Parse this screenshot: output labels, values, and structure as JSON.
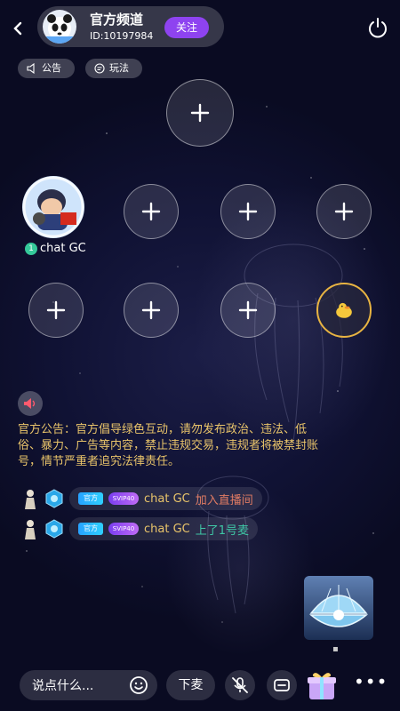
{
  "header": {
    "back_icon": "chevron-left-icon",
    "room_title": "官方频道",
    "room_id": "ID:10197984",
    "follow_label": "关注",
    "power_icon": "power-icon"
  },
  "chips": {
    "announcement_label": "公告",
    "gameplay_label": "玩法"
  },
  "seats": {
    "user_seat_number": "1",
    "user_name": "chat GC"
  },
  "chat": {
    "announcement": "官方公告：官方倡导绿色互动，请勿发布政治、违法、低俗、暴力、广告等内容，禁止违规交易，违规者将被禁封账号，情节严重者追究法律责任。",
    "messages": [
      {
        "badge_official": "官方",
        "badge_svip": "SVIP40",
        "user": "chat GC",
        "action": "加入直播间"
      },
      {
        "badge_official": "官方",
        "badge_svip": "SVIP40",
        "user": "chat GC",
        "action": "上了1号麦"
      }
    ]
  },
  "bottom_bar": {
    "input_placeholder": "说点什么...",
    "down_mic_label": "下麦",
    "more_icon": "more-dots-icon"
  },
  "colors": {
    "accent_purple": "#8e43f0",
    "announcement_text": "#e9c46a",
    "seat_gold": "#e8b442"
  }
}
